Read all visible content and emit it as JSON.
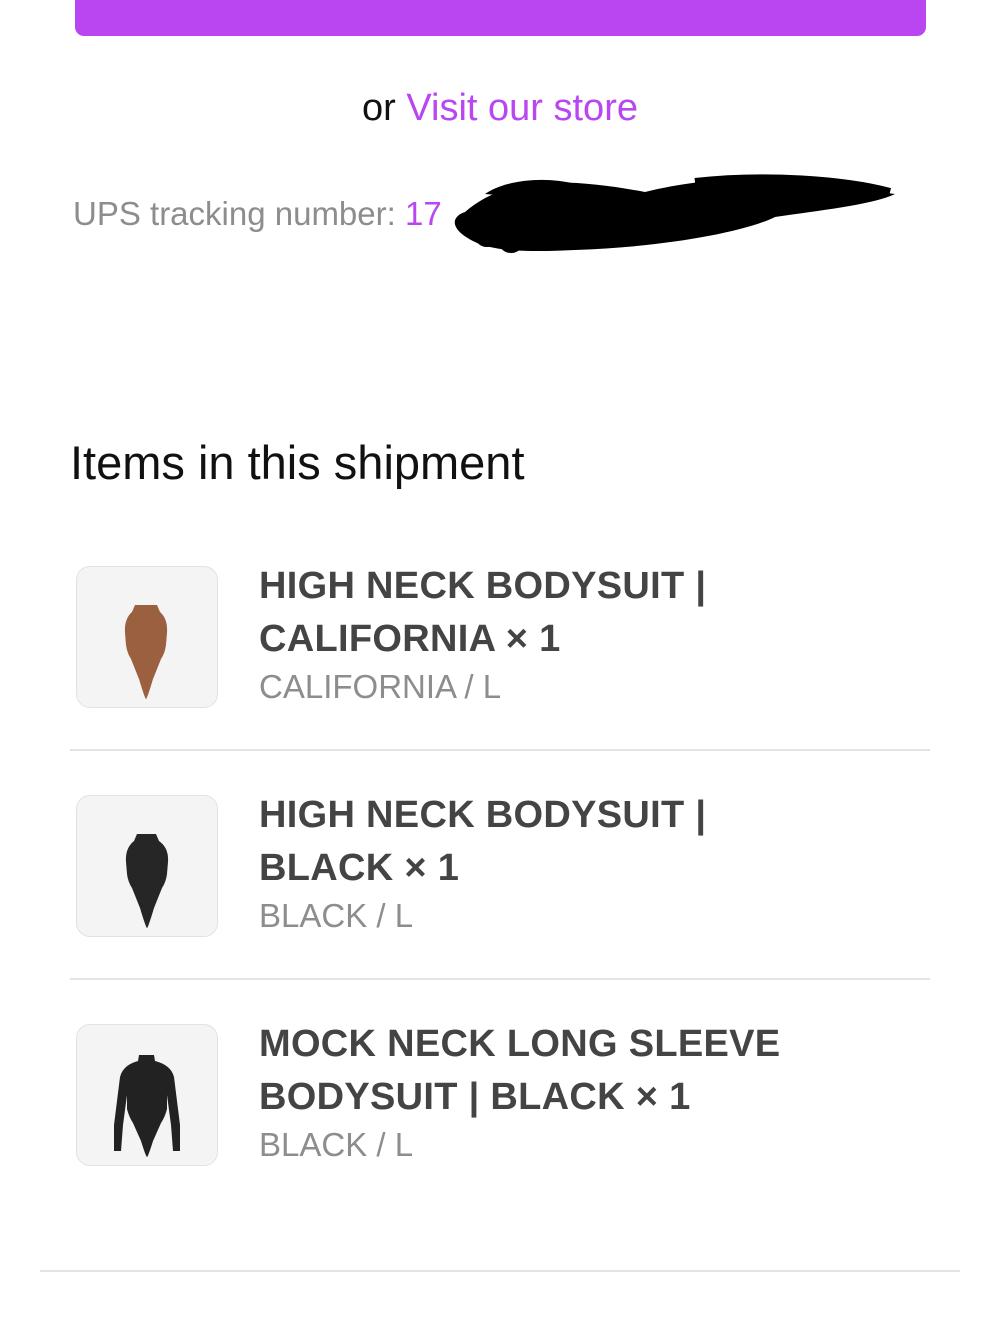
{
  "header": {
    "or_text": "or",
    "store_link": "Visit our store",
    "accent": "#b946f0"
  },
  "tracking": {
    "label": "UPS tracking number:",
    "visible_prefix": "17"
  },
  "shipment": {
    "title": "Items in this shipment",
    "items": [
      {
        "line1": "HIGH NECK BODYSUIT |",
        "line2": "CALIFORNIA × 1",
        "variant": "CALIFORNIA / L",
        "swatch": "#9a6040",
        "icon": "bodysuit-sleeveless-icon"
      },
      {
        "line1": "HIGH NECK BODYSUIT |",
        "line2": "BLACK × 1",
        "variant": "BLACK / L",
        "swatch": "#262626",
        "icon": "bodysuit-sleeveless-icon"
      },
      {
        "line1": "MOCK NECK LONG SLEEVE",
        "line2": "BODYSUIT | BLACK × 1",
        "variant": "BLACK / L",
        "swatch": "#222222",
        "icon": "bodysuit-long-sleeve-icon"
      }
    ]
  }
}
